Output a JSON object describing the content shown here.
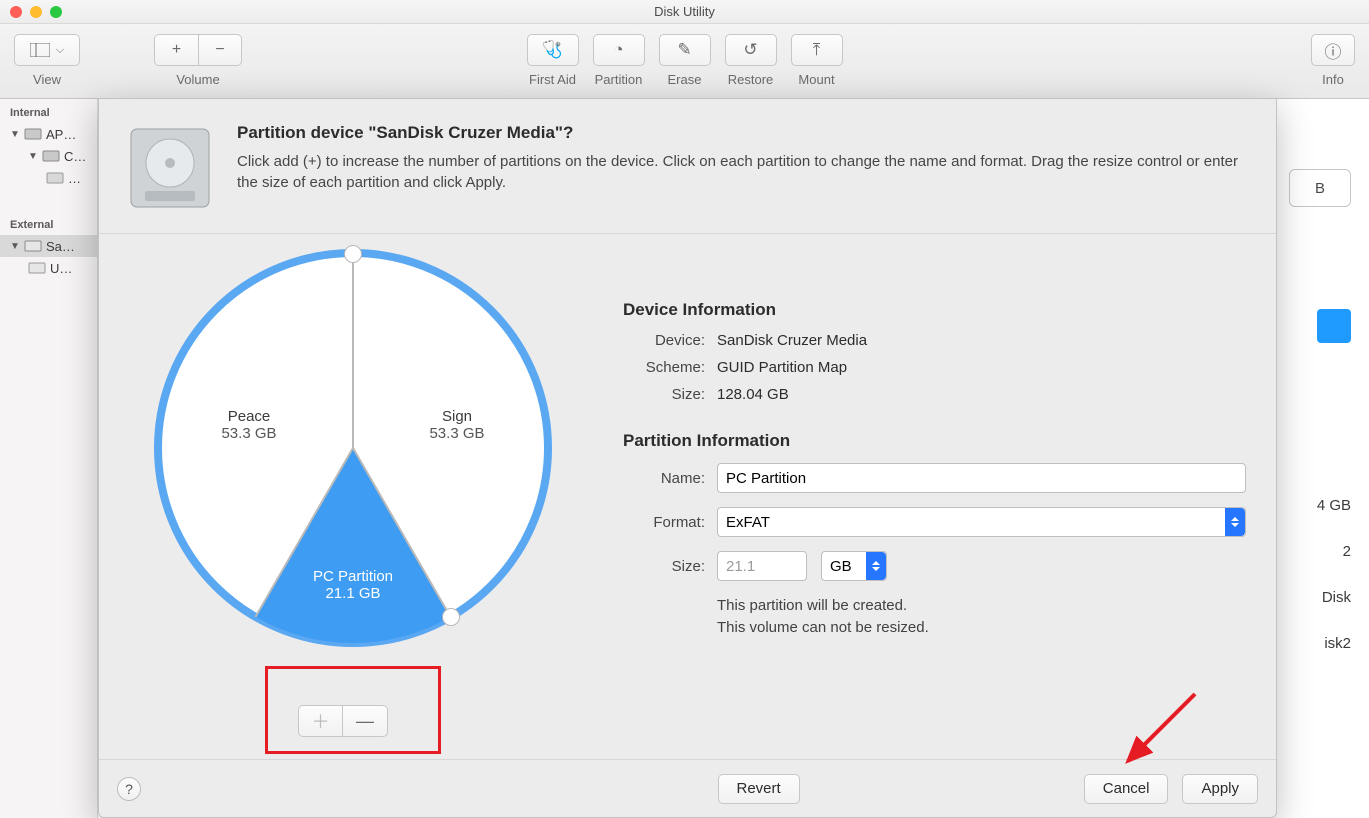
{
  "window": {
    "title": "Disk Utility"
  },
  "toolbar": {
    "view": "View",
    "volume": "Volume",
    "firstaid": "First Aid",
    "partition": "Partition",
    "erase": "Erase",
    "restore": "Restore",
    "mount": "Mount",
    "info": "Info"
  },
  "sidebar": {
    "internal_header": "Internal",
    "external_header": "External",
    "items": {
      "apple": "AP…",
      "container": "C…",
      "vol": "…",
      "sandisk": "Sa…",
      "usb": "U…"
    }
  },
  "bg": {
    "pill": "B",
    "r1": "4 GB",
    "r2": "2",
    "r3": "Disk",
    "r4": "isk2"
  },
  "sheet": {
    "title": "Partition device \"SanDisk Cruzer Media\"?",
    "desc": "Click add (+) to increase the number of partitions on the device. Click on each partition to change the name and format. Drag the resize control or enter the size of each partition and click Apply.",
    "partitions": [
      {
        "name": "Peace",
        "size": "53.3 GB"
      },
      {
        "name": "Sign",
        "size": "53.3 GB"
      },
      {
        "name": "PC Partition",
        "size": "21.1 GB"
      }
    ],
    "device_info": {
      "header": "Device Information",
      "device_k": "Device:",
      "device_v": "SanDisk Cruzer Media",
      "scheme_k": "Scheme:",
      "scheme_v": "GUID Partition Map",
      "size_k": "Size:",
      "size_v": "128.04 GB"
    },
    "partition_info": {
      "header": "Partition Information",
      "name_k": "Name:",
      "name_v": "PC Partition",
      "format_k": "Format:",
      "format_v": "ExFAT",
      "size_k": "Size:",
      "size_v": "21.1",
      "unit": "GB",
      "hint1": "This partition will be created.",
      "hint2": "This volume can not be resized."
    },
    "buttons": {
      "revert": "Revert",
      "cancel": "Cancel",
      "apply": "Apply"
    }
  }
}
